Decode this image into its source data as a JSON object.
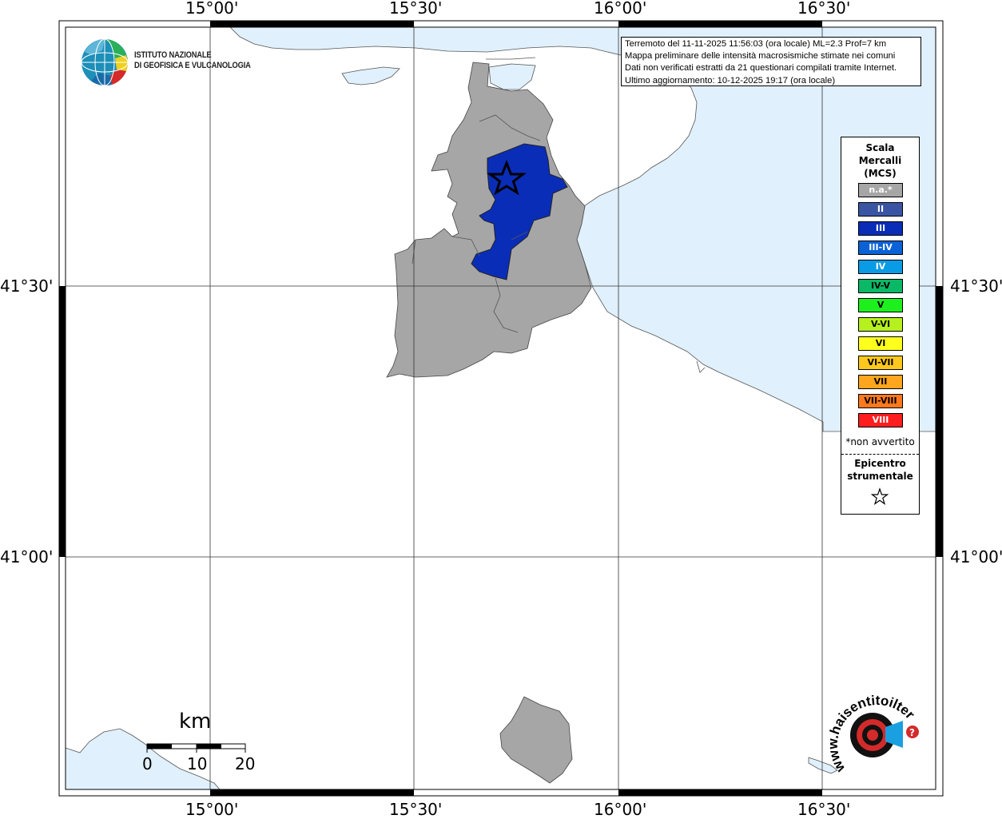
{
  "info": {
    "line1": "Terremoto del 11-11-2025 11:56:03 (ora locale) ML=2.3 Prof=7 km",
    "line2": "Mappa preliminare delle intensità macrosismiche stimate nei comuni",
    "line3": "Dati non verificati estratti da 21 questionari compilati tramite Internet.",
    "line4": "Ultimo aggiornamento: 10-12-2025 19:17 (ora locale)"
  },
  "logo": {
    "line1": "ISTITUTO NAZIONALE",
    "line2": "DI GEOFISICA E VULCANOLOGIA"
  },
  "axes": {
    "lon_top": [
      "15°00'",
      "15°30'",
      "16°00'",
      "16°30'"
    ],
    "lon_bottom": [
      "15°00'",
      "15°30'",
      "16°00'",
      "16°30'"
    ],
    "lat_left": [
      "41°30'",
      "41°00'"
    ],
    "lat_right": [
      "41°30'",
      "41°00'"
    ]
  },
  "legend": {
    "title_1": "Scala",
    "title_2": "Mercalli",
    "title_3": "(MCS)",
    "items": [
      {
        "label": "n.a.*",
        "color": "#a6a6a6",
        "text_color": "#ffffff"
      },
      {
        "label": "II",
        "color": "#3a55a3",
        "text_color": "#ffffff"
      },
      {
        "label": "III",
        "color": "#0a2db8",
        "text_color": "#ffffff"
      },
      {
        "label": "III-IV",
        "color": "#0a62d6",
        "text_color": "#ffffff"
      },
      {
        "label": "IV",
        "color": "#0a9be6",
        "text_color": "#ffffff"
      },
      {
        "label": "IV-V",
        "color": "#0ab866",
        "text_color": "#000000"
      },
      {
        "label": "V",
        "color": "#1ef01e",
        "text_color": "#000000"
      },
      {
        "label": "V-VI",
        "color": "#b6f01e",
        "text_color": "#000000"
      },
      {
        "label": "VI",
        "color": "#ffff1e",
        "text_color": "#000000"
      },
      {
        "label": "VI-VII",
        "color": "#ffc81e",
        "text_color": "#000000"
      },
      {
        "label": "VII",
        "color": "#ffa51e",
        "text_color": "#000000"
      },
      {
        "label": "VII-VIII",
        "color": "#ff781e",
        "text_color": "#000000"
      },
      {
        "label": "VIII",
        "color": "#ff1e1e",
        "text_color": "#ffffff"
      }
    ],
    "note": "*non avvertito",
    "epicenter_1": "Epicentro",
    "epicenter_2": "strumentale"
  },
  "scale_bar": {
    "unit": "km",
    "labels": [
      "0",
      "10",
      "20"
    ]
  },
  "colors": {
    "sea": "#e0f0fc",
    "land_na": "#a6a6a6",
    "intensity_iii": "#0a2db8"
  },
  "hai_sentito": {
    "text": "www.haisentitoilterremoto.it",
    "question": "?"
  }
}
